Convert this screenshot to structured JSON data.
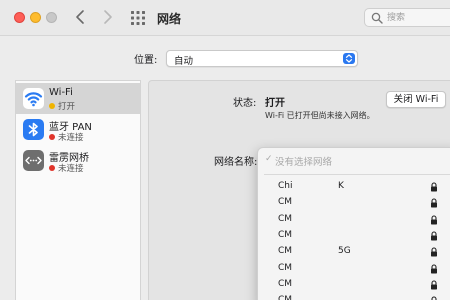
{
  "toolbar": {
    "title": "网络",
    "search_placeholder": "搜索"
  },
  "location": {
    "label": "位置:",
    "value": "自动"
  },
  "services": [
    {
      "name": "Wi-Fi",
      "status": "打开",
      "status_color": "#f0b400",
      "icon": "wifi-icon",
      "icon_color": "#2a7bf2",
      "selected": true
    },
    {
      "name": "蓝牙 PAN",
      "status": "未连接",
      "status_color": "#e0342a",
      "icon": "bluetooth-icon",
      "icon_color": "#2a7bf2",
      "selected": false
    },
    {
      "name": "雷雳网桥",
      "status": "未连接",
      "status_color": "#e0342a",
      "icon": "thunderbolt-bridge-icon",
      "icon_color": "#6e6e6e",
      "selected": false
    }
  ],
  "detail": {
    "status_label": "状态:",
    "status_value": "打开",
    "wifi_off_button": "关闭 Wi-Fi",
    "status_description": "Wi-Fi 已打开但尚未接入网络。",
    "network_name_label": "网络名称:"
  },
  "network_menu": {
    "no_selection": "没有选择网络",
    "networks": [
      {
        "prefix": "Chi",
        "suffix": "K",
        "locked": true
      },
      {
        "prefix": "CM",
        "suffix": "",
        "locked": true
      },
      {
        "prefix": "CM",
        "suffix": "",
        "locked": true
      },
      {
        "prefix": "CM",
        "suffix": "",
        "locked": true
      },
      {
        "prefix": "CM",
        "suffix": "5G",
        "locked": true
      },
      {
        "prefix": "CM",
        "suffix": "",
        "locked": true
      },
      {
        "prefix": "CM",
        "suffix": "",
        "locked": true
      },
      {
        "prefix": "CM",
        "suffix": "",
        "locked": true
      }
    ]
  },
  "colors": {
    "accent": "#2a78f0",
    "close": "#fe5f57",
    "minimize": "#febc2e"
  }
}
